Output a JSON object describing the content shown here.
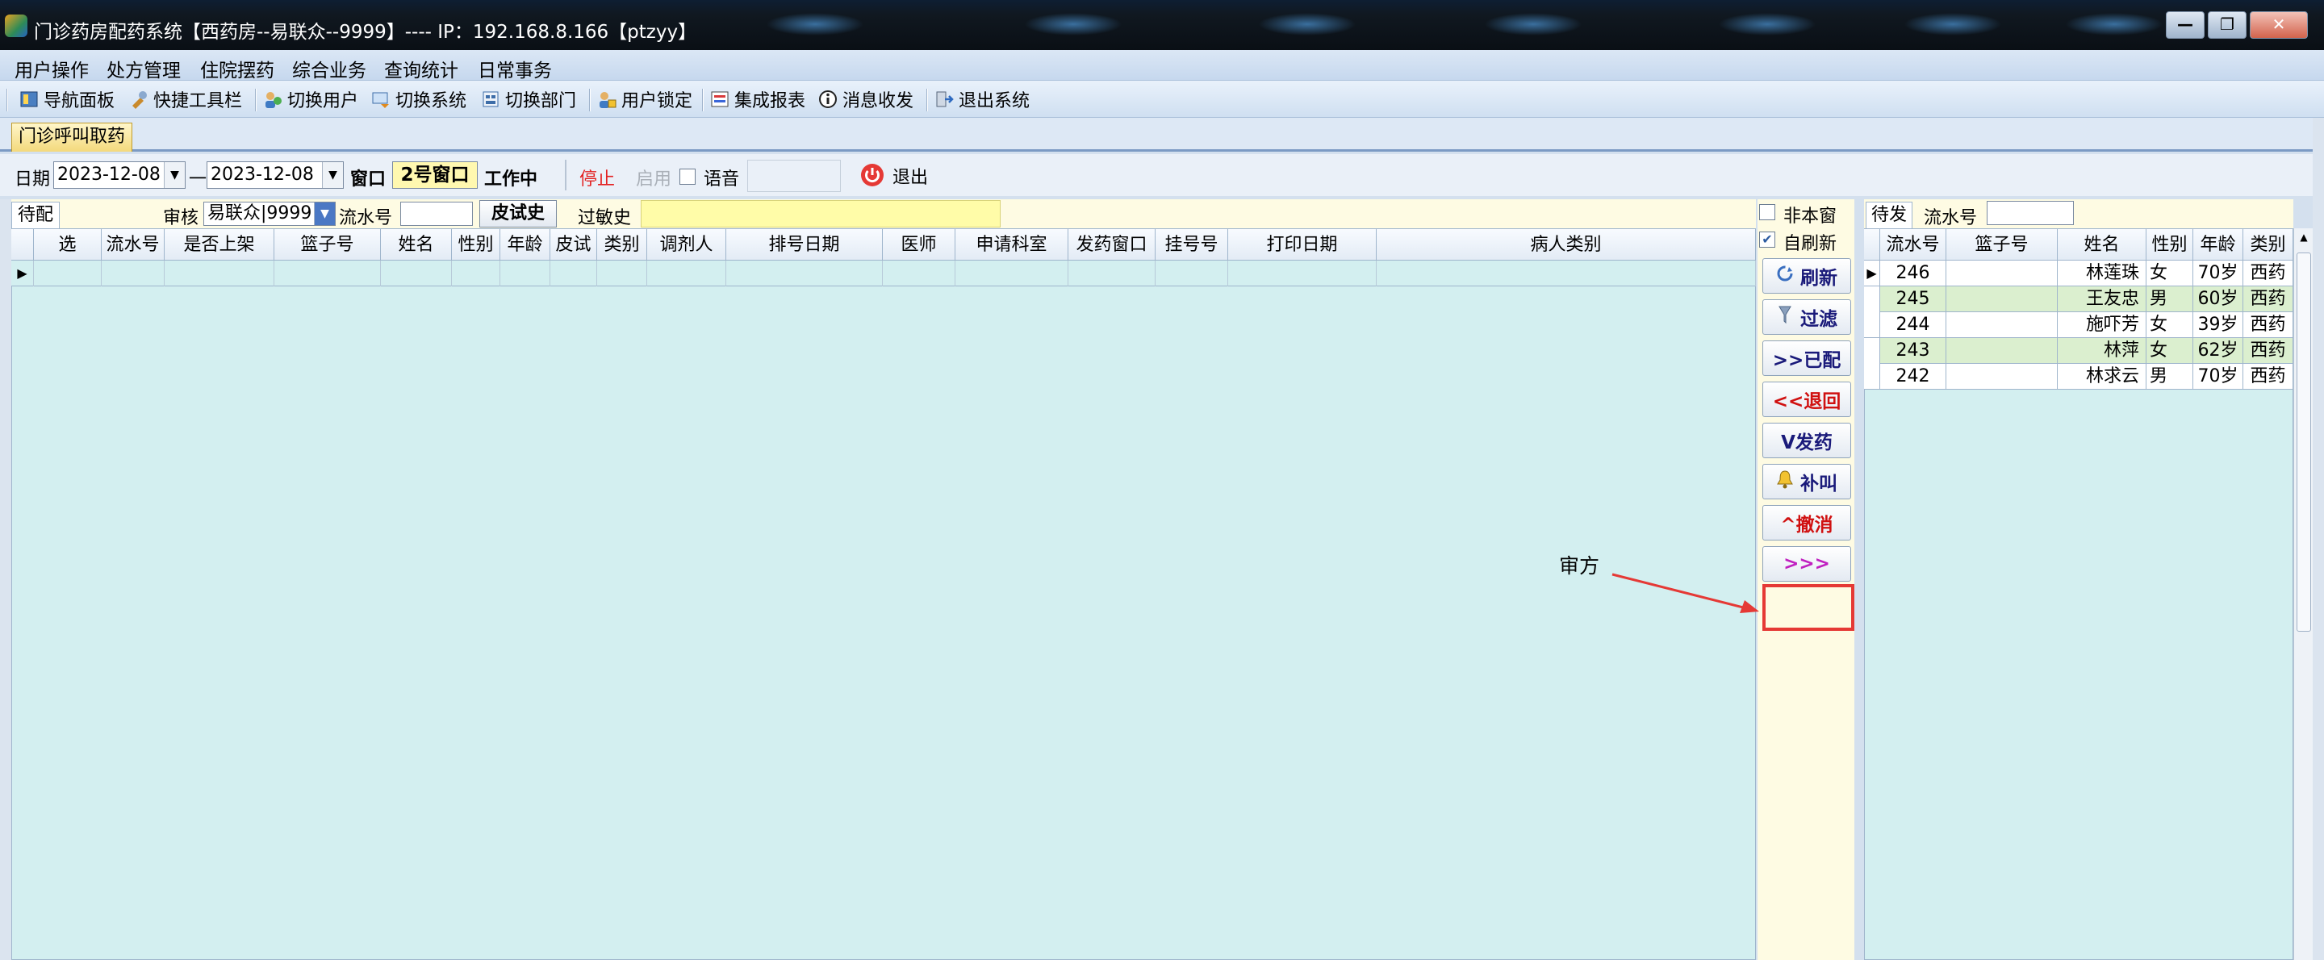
{
  "window": {
    "title": "门诊药房配药系统【西药房--易联众--9999】---- IP：192.168.8.166【ptzyy】",
    "controls": {
      "minimize": "—",
      "maximize": "❐",
      "close": "✕"
    }
  },
  "menu": [
    "用户操作",
    "处方管理",
    "住院摆药",
    "综合业务",
    "查询统计",
    "日常事务"
  ],
  "toolbar": [
    {
      "label": "导航面板",
      "icon": "navigation-panel-icon"
    },
    {
      "label": "快捷工具栏",
      "icon": "quick-toolbar-icon"
    },
    {
      "label": "切换用户",
      "icon": "switch-user-icon"
    },
    {
      "label": "切换系统",
      "icon": "switch-system-icon"
    },
    {
      "label": "切换部门",
      "icon": "switch-department-icon"
    },
    {
      "label": "用户锁定",
      "icon": "user-lock-icon"
    },
    {
      "label": "集成报表",
      "icon": "report-icon"
    },
    {
      "label": "消息收发",
      "icon": "info-icon"
    },
    {
      "label": "退出系统",
      "icon": "exit-system-icon"
    }
  ],
  "main_tab": "门诊呼叫取药",
  "filter": {
    "date_label": "日期",
    "date_from": "2023-12-08",
    "date_sep": "一",
    "date_to": "2023-12-08",
    "window_label": "窗口",
    "window_value": "2号窗口",
    "status": "工作中",
    "stop": "停止",
    "enable": "启用",
    "voice_label": "语音",
    "exit": "退出"
  },
  "left": {
    "tab": "待配",
    "review_label": "审核",
    "review_value": "易联众|9999",
    "serial_label": "流水号",
    "skin_test_button": "皮试史",
    "allergy_label": "过敏史",
    "columns": [
      "选",
      "流水号",
      "是否上架",
      "篮子号",
      "姓名",
      "性别",
      "年龄",
      "皮试",
      "类别",
      "调剂人",
      "排号日期",
      "医师",
      "申请科室",
      "发药窗口",
      "挂号号",
      "打印日期",
      "病人类别"
    ]
  },
  "side": {
    "not_this_window": "非本窗",
    "auto_refresh": "自刷新",
    "auto_refresh_checked": true,
    "buttons": [
      {
        "label": "刷新",
        "icon": "refresh-icon",
        "color": "#1a1a7a"
      },
      {
        "label": "过滤",
        "icon": "filter-icon",
        "color": "#1a1a7a"
      },
      {
        "label": ">>已配",
        "icon": "",
        "color": "#1a1a7a"
      },
      {
        "label": "<<退回",
        "icon": "",
        "color": "#d01010"
      },
      {
        "label": "V发药",
        "icon": "",
        "color": "#1a1a7a"
      },
      {
        "label": "补叫",
        "icon": "bell-icon",
        "color": "#1a1a7a"
      },
      {
        "label": "^撤消",
        "icon": "",
        "color": "#d01010"
      },
      {
        "label": ">>>",
        "icon": "",
        "color": "#c020c0"
      }
    ]
  },
  "annotation": {
    "label": "审方",
    "color": "#e53935"
  },
  "right": {
    "tab": "待发",
    "serial_label": "流水号",
    "columns": [
      "流水号",
      "篮子号",
      "姓名",
      "性别",
      "年龄",
      "类别"
    ],
    "rows": [
      {
        "serial": "246",
        "basket": "",
        "name": "林莲珠",
        "gender": "女",
        "age": "70岁",
        "type": "西药"
      },
      {
        "serial": "245",
        "basket": "",
        "name": "王友忠",
        "gender": "男",
        "age": "60岁",
        "type": "西药"
      },
      {
        "serial": "244",
        "basket": "",
        "name": "施吓芳",
        "gender": "女",
        "age": "39岁",
        "type": "西药"
      },
      {
        "serial": "243",
        "basket": "",
        "name": "林萍",
        "gender": "女",
        "age": "62岁",
        "type": "西药"
      },
      {
        "serial": "242",
        "basket": "",
        "name": "林求云",
        "gender": "男",
        "age": "70岁",
        "type": "西药"
      }
    ]
  }
}
